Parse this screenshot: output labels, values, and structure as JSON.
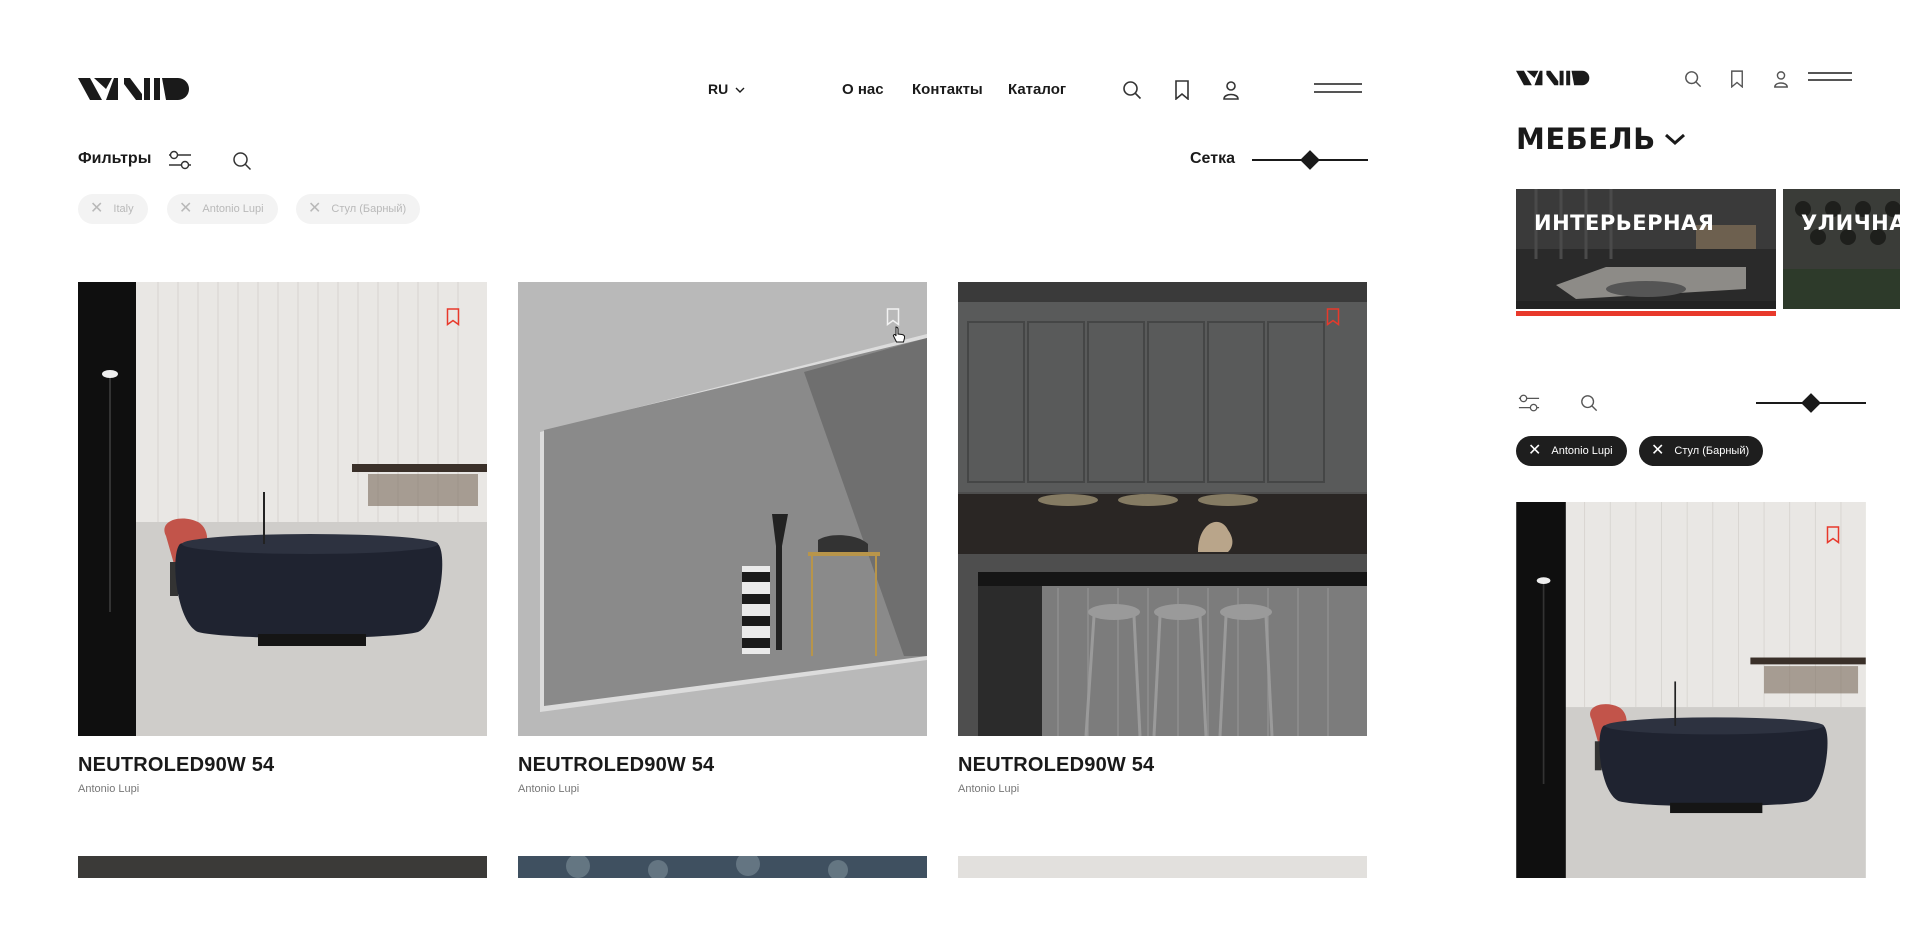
{
  "desktop": {
    "header": {
      "lang": "RU",
      "nav": [
        "О нас",
        "Контакты",
        "Каталог"
      ]
    },
    "toolbar": {
      "filters_label": "Фильтры",
      "grid_label": "Сетка",
      "grid_level": 0.5
    },
    "chips": [
      "Italy",
      "Antonio Lupi",
      "Стул (Барный)"
    ],
    "products": [
      {
        "title": "NEUTROLED90W 54",
        "brand": "Antonio Lupi",
        "bookmarked": true
      },
      {
        "title": "NEUTROLED90W 54",
        "brand": "Antonio Lupi",
        "bookmarked": false
      },
      {
        "title": "NEUTROLED90W 54",
        "brand": "Antonio Lupi",
        "bookmarked": true
      }
    ]
  },
  "mobile": {
    "section_title": "МЕБЕЛЬ",
    "categories": [
      "ИНТЕРЬЕРНАЯ",
      "УЛИЧНАЯ"
    ],
    "chips": [
      "Antonio Lupi",
      "Стул (Барный)"
    ],
    "grid_level": 0.5
  },
  "colors": {
    "accent": "#e8392b",
    "dark": "#1a1a1a",
    "muted_chip_bg": "#f3f3f3",
    "muted_chip_text": "#b9b9b9"
  },
  "icons": [
    "search-icon",
    "bookmark-icon",
    "user-icon",
    "menu-icon",
    "filter-icon",
    "close-icon",
    "chevron-down-icon",
    "cursor-icon"
  ]
}
